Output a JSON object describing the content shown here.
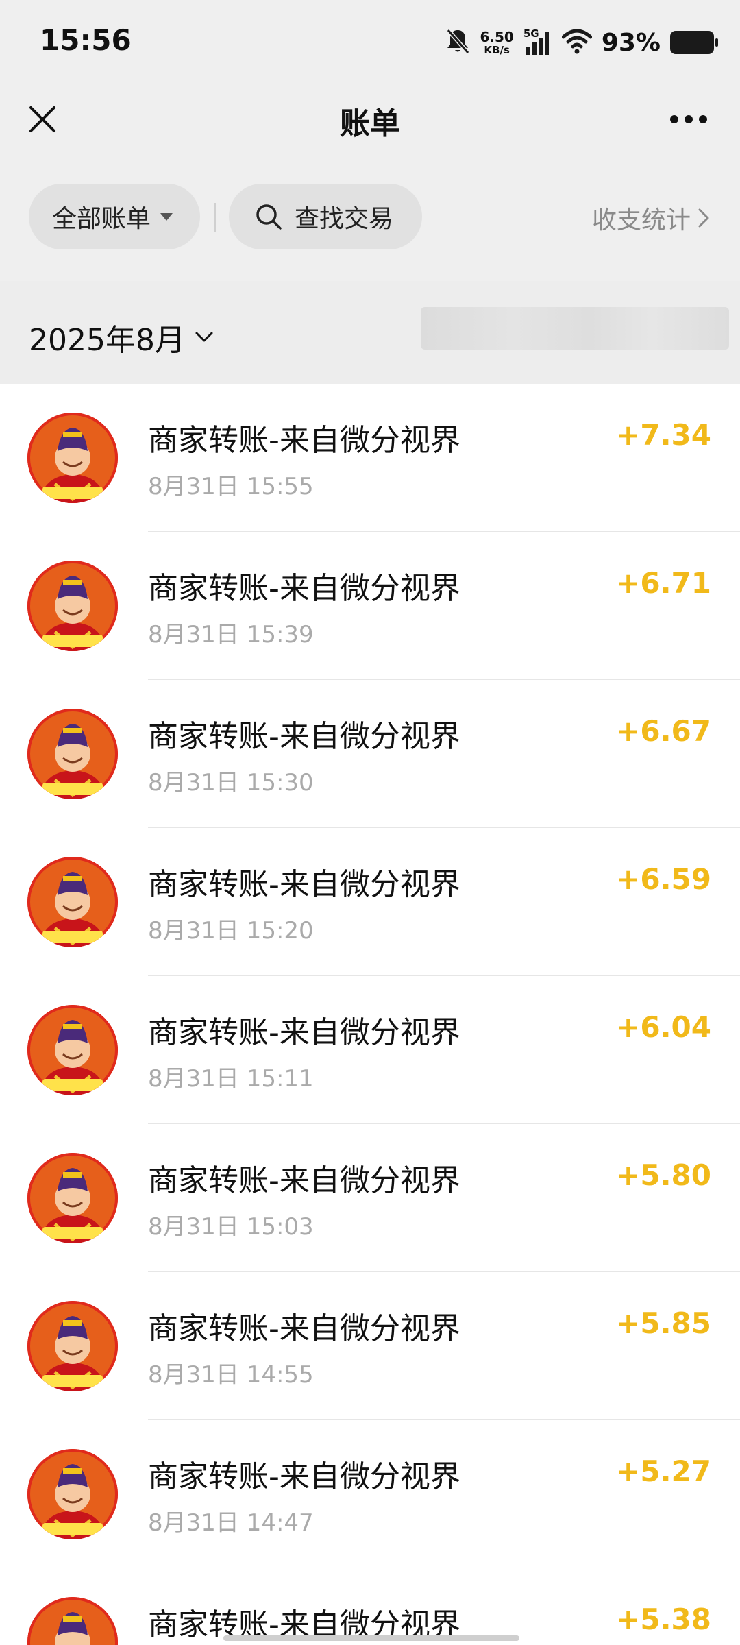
{
  "status_bar": {
    "time": "15:56",
    "net_speed_value": "6.50",
    "net_speed_unit": "KB/s",
    "network_type": "5G",
    "battery_percent": "93%",
    "icons": [
      "bell-muted-icon",
      "signal-icon",
      "wifi-icon",
      "battery-icon"
    ]
  },
  "header": {
    "title": "账单",
    "close_icon": "close-icon",
    "more_icon": "more-icon"
  },
  "filters": {
    "all_bills_label": "全部账单",
    "search_label": "查找交易",
    "stats_label": "收支统计"
  },
  "month": {
    "label": "2025年8月"
  },
  "transactions": [
    {
      "title": "商家转账-来自微分视界",
      "time": "8月31日 15:55",
      "amount": "+7.34"
    },
    {
      "title": "商家转账-来自微分视界",
      "time": "8月31日 15:39",
      "amount": "+6.71"
    },
    {
      "title": "商家转账-来自微分视界",
      "time": "8月31日 15:30",
      "amount": "+6.67"
    },
    {
      "title": "商家转账-来自微分视界",
      "time": "8月31日 15:20",
      "amount": "+6.59"
    },
    {
      "title": "商家转账-来自微分视界",
      "time": "8月31日 15:11",
      "amount": "+6.04"
    },
    {
      "title": "商家转账-来自微分视界",
      "time": "8月31日 15:03",
      "amount": "+5.80"
    },
    {
      "title": "商家转账-来自微分视界",
      "time": "8月31日 14:55",
      "amount": "+5.85"
    },
    {
      "title": "商家转账-来自微分视界",
      "time": "8月31日 14:47",
      "amount": "+5.27"
    },
    {
      "title": "商家转账-来自微分视界",
      "time": "",
      "amount": "+5.38"
    }
  ],
  "colors": {
    "amount": "#f1b91a",
    "header_bg": "#efefef",
    "avatar_bg": "#e02a1c"
  }
}
